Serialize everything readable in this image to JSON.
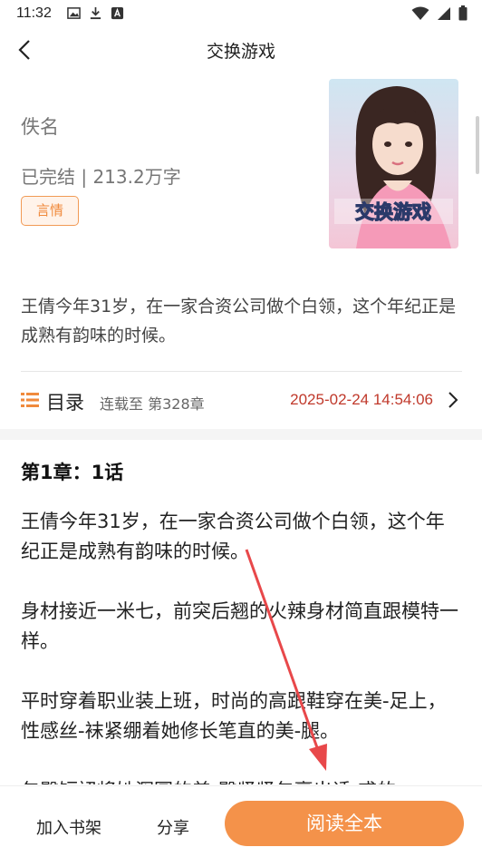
{
  "status_bar": {
    "time": "11:32"
  },
  "nav": {
    "title": "交换游戏"
  },
  "book": {
    "author": "佚名",
    "status": "已完结 | 213.2万字",
    "tag": "言情",
    "cover_title": "交换游戏",
    "synopsis": "王倩今年31岁，在一家合资公司做个白领，这个年纪正是成熟有韵味的时候。"
  },
  "toc": {
    "label": "目录",
    "serial": "连载至 第328章",
    "updated": "2025-02-24 14:54:06"
  },
  "chapter": {
    "title": "第1章：1话",
    "paragraphs": [
      "王倩今年31岁，在一家合资公司做个白领，这个年纪正是成熟有韵味的时候。",
      "身材接近一米七，前突后翘的火辣身材简直跟模特一样。",
      "平时穿着职业装上班，时尚的高跟鞋穿在美-足上，性感丝-袜紧绷着她修长笔直的美-腿。",
      "包臀短裙将她浑圆的美-臀紧紧包裹出诱-惑的"
    ]
  },
  "bottom_bar": {
    "add_shelf": "加入书架",
    "share": "分享",
    "read_all": "阅读全本"
  },
  "colors": {
    "accent": "#f4924a",
    "date_red": "#c0392b",
    "annotation_arrow": "#e8484a"
  }
}
